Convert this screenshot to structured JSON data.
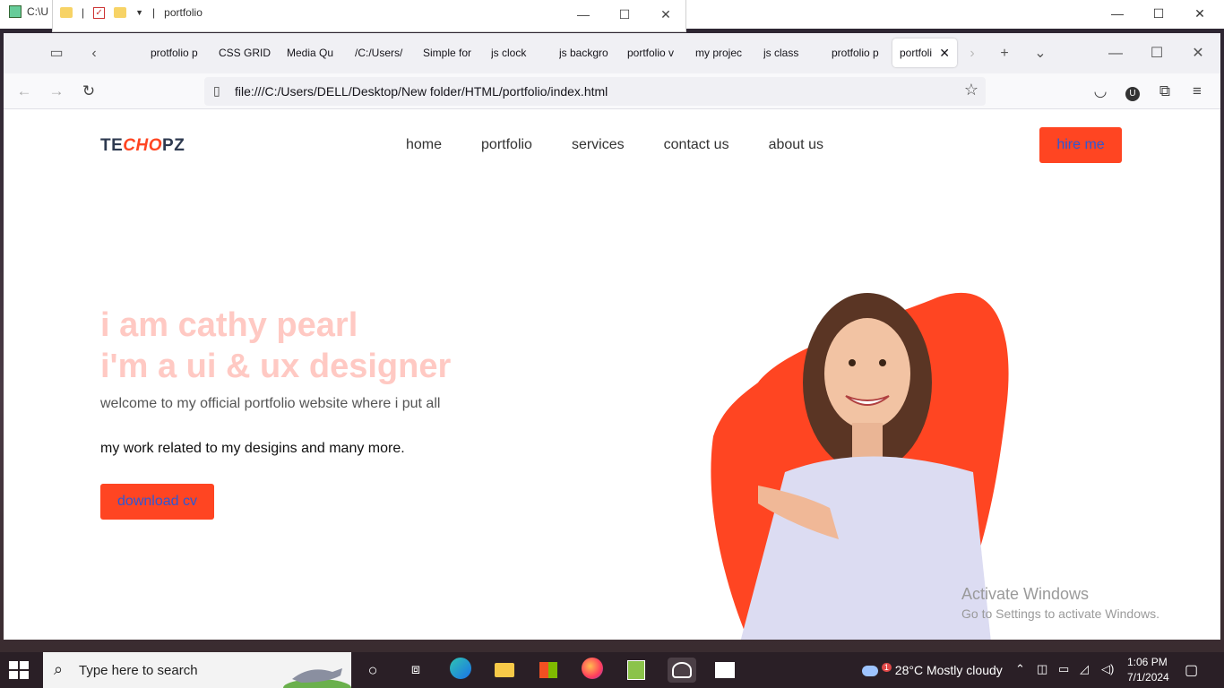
{
  "desktop_window": {
    "path_fragment": "C:\\U",
    "minimize": "—",
    "maximize": "☐",
    "close": "✕"
  },
  "explorer": {
    "separator": "|",
    "title": "portfolio",
    "minimize": "—",
    "maximize": "☐",
    "close": "✕"
  },
  "browser": {
    "tabs": [
      {
        "label": "protfolio p",
        "active": false
      },
      {
        "label": "CSS GRID",
        "active": false
      },
      {
        "label": "Media Qu",
        "active": false
      },
      {
        "label": "/C:/Users/",
        "active": false
      },
      {
        "label": "Simple for",
        "active": false
      },
      {
        "label": "js clock",
        "active": false
      },
      {
        "label": "js backgro",
        "active": false
      },
      {
        "label": "portfolio v",
        "active": false
      },
      {
        "label": "my projec",
        "active": false
      },
      {
        "label": "js class",
        "active": false
      },
      {
        "label": "protfolio p",
        "active": false
      },
      {
        "label": "portfoli",
        "active": true
      }
    ],
    "url": "file:///C:/Users/DELL/Desktop/New folder/HTML/portfolio/index.html"
  },
  "page": {
    "logo_prefix": "TE",
    "logo_accent": "CHO",
    "logo_suffix": "PZ",
    "menu": [
      "home",
      "portfolio",
      "services",
      "contact us",
      "about us"
    ],
    "hire_button": "hire me",
    "headline_1": "i am cathy pearl",
    "headline_2": "i'm a ui & ux designer",
    "paragraph_1": "welcome to my official portfolio website where i put all",
    "paragraph_2": "my work related to my desigins and many more.",
    "download_button": "download cv",
    "accent_color": "#ff4522",
    "headline_color": "#ffc9c3"
  },
  "watermark": {
    "line1": "Activate Windows",
    "line2": "Go to Settings to activate Windows."
  },
  "taskbar": {
    "search_placeholder": "Type here to search",
    "weather": "28°C  Mostly cloudy",
    "weather_badge": "1",
    "time": "1:06 PM",
    "date": "7/1/2024"
  }
}
